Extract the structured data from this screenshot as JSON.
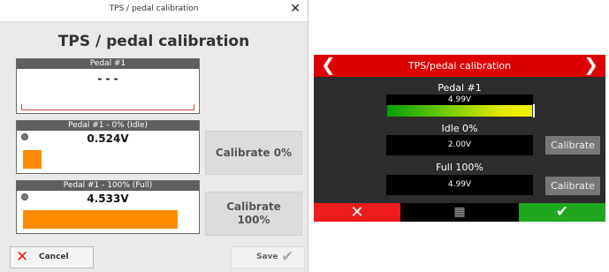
{
  "dialog": {
    "window_title": "TPS / pedal calibration",
    "close_glyph": "✕",
    "heading": "TPS / pedal calibration",
    "panels": [
      {
        "title": "Pedal #1",
        "value": "- - -"
      },
      {
        "title": "Pedal #1 - 0% (Idle)",
        "value": "0.524V",
        "bar_fraction": 0.11
      },
      {
        "title": "Pedal #1 - 100% (Full)",
        "value": "4.533V",
        "bar_fraction": 0.9
      }
    ],
    "calibrate_0_label": "Calibrate 0%",
    "calibrate_100_label": "Calibrate 100%",
    "cancel_label": "Cancel",
    "save_label": "Save",
    "accent_color": "#ff8c00"
  },
  "device": {
    "title": "TPS/pedal calibration",
    "left_arrow": "❮",
    "right_arrow": "❯",
    "pedal_label": "Pedal #1",
    "pedal_value": "4.99V",
    "pedal_level": 1.0,
    "idle_label": "Idle 0%",
    "idle_value": "2.00V",
    "full_label": "Full 100%",
    "full_value": "4.99V",
    "calibrate_label": "Calibrate",
    "header_color": "#dd0000",
    "ok_color": "#1fa81f",
    "cancel_color": "#ee1c1c"
  }
}
